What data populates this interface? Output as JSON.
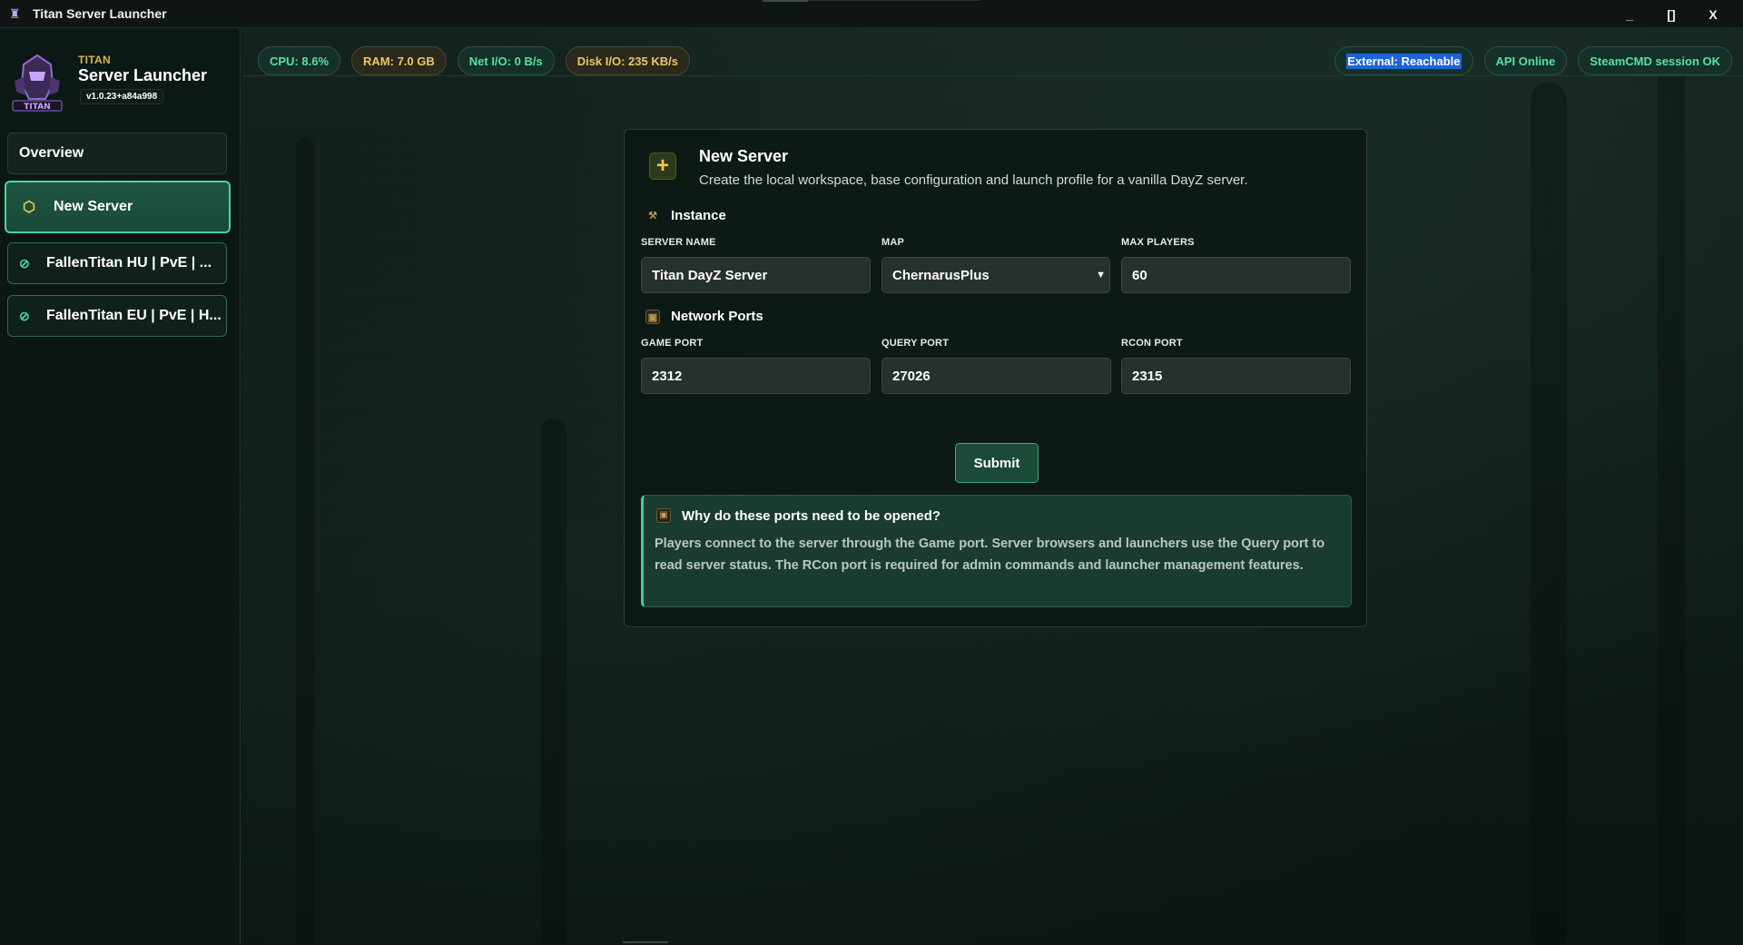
{
  "window": {
    "title": "Titan Server Launcher",
    "minimize_label": "_",
    "maximize_label": "[]",
    "close_label": "X"
  },
  "sidebar": {
    "brand_small": "TITAN",
    "brand_big": "Server Launcher",
    "version": "v1.0.23+a84a998",
    "items": [
      {
        "label": "Overview"
      },
      {
        "label": "New Server",
        "icon": "cube-icon",
        "active": true
      },
      {
        "label": "FallenTitan HU | PvE | ...",
        "icon": "check-circle-icon",
        "status": "running"
      },
      {
        "label": "FallenTitan EU | PvE | H...",
        "icon": "check-circle-icon",
        "status": "running"
      }
    ]
  },
  "status": {
    "cpu": "CPU: 8.6%",
    "ram": "RAM: 7.0 GB",
    "net": "Net I/O: 0 B/s",
    "disk": "Disk I/O: 235 KB/s",
    "external": "External: Reachable",
    "api": "API Online",
    "steamcmd": "SteamCMD session OK"
  },
  "form": {
    "title": "New Server",
    "description": "Create the local workspace, base configuration and launch profile for a vanilla DayZ server.",
    "instance_heading": "Instance",
    "server_name_label": "SERVER NAME",
    "server_name_value": "Titan DayZ Server",
    "map_label": "MAP",
    "map_value": "ChernarusPlus",
    "max_players_label": "MAX PLAYERS",
    "max_players_value": "60",
    "ports_heading": "Network Ports",
    "game_port_label": "GAME PORT",
    "game_port_value": "2312",
    "query_port_label": "QUERY PORT",
    "query_port_value": "27026",
    "rcon_port_label": "RCON PORT",
    "rcon_port_value": "2315",
    "submit_label": "Submit"
  },
  "info": {
    "title": "Why do these ports need to be opened?",
    "body": "Players connect to the server through the Game port. Server browsers and launchers use the Query port to read server status. The RCon port is required for admin commands and launcher management features."
  },
  "colors": {
    "accent": "#4bd59a",
    "amber": "#f0c46a",
    "background": "#0f1b17"
  }
}
